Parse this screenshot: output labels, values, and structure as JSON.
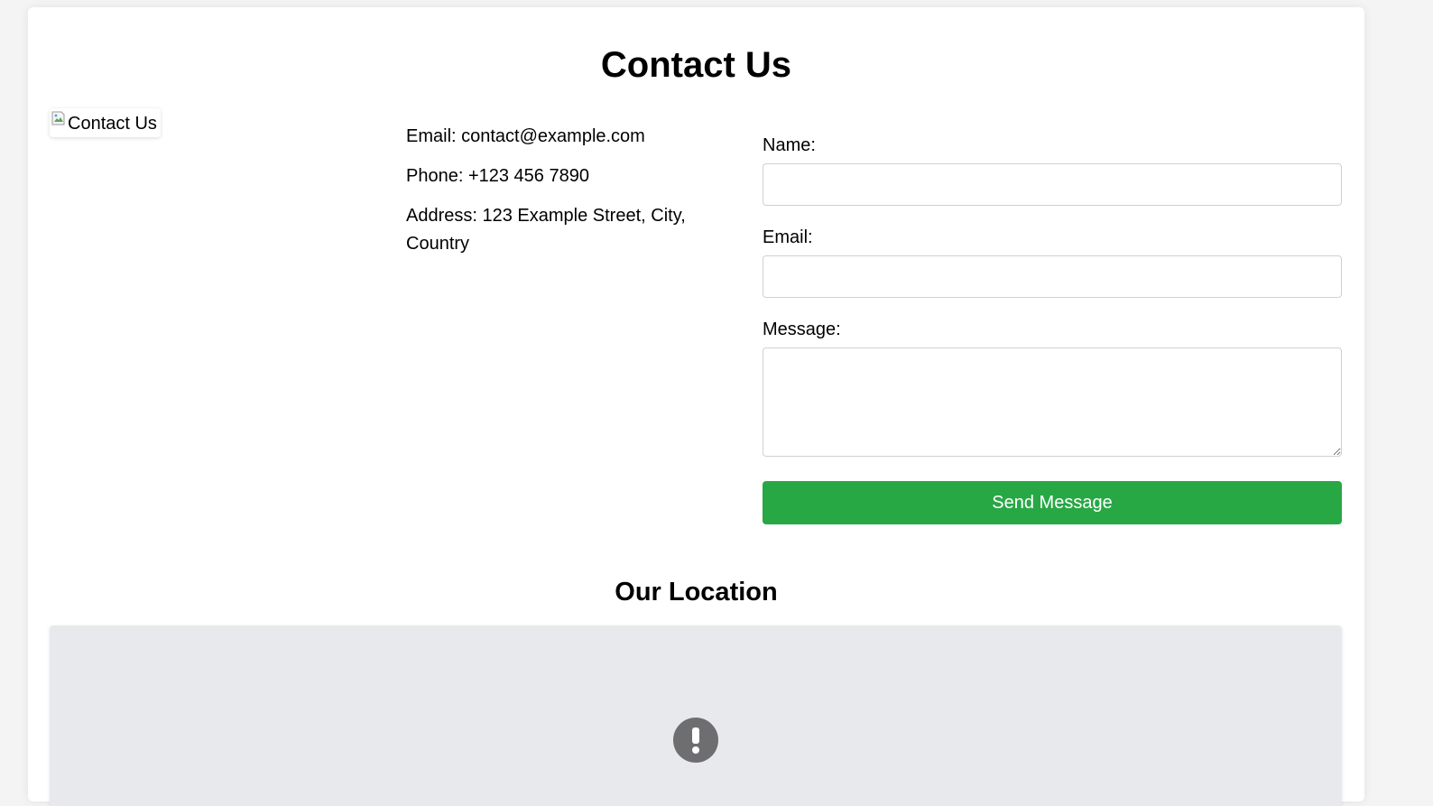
{
  "page": {
    "title": "Contact Us"
  },
  "image": {
    "alt": "Contact Us"
  },
  "contact_info": {
    "email": "Email: contact@example.com",
    "phone": "Phone: +123 456 7890",
    "address": "Address: 123 Example Street, City, Country"
  },
  "form": {
    "name_label": "Name:",
    "name_value": "",
    "email_label": "Email:",
    "email_value": "",
    "message_label": "Message:",
    "message_value": "",
    "submit_label": "Send Message"
  },
  "location": {
    "title": "Our Location",
    "map_status_icon": "exclamation-icon"
  },
  "colors": {
    "accent": "#28a745",
    "map_background": "#e8e9ec",
    "page_background": "#f4f4f4"
  }
}
